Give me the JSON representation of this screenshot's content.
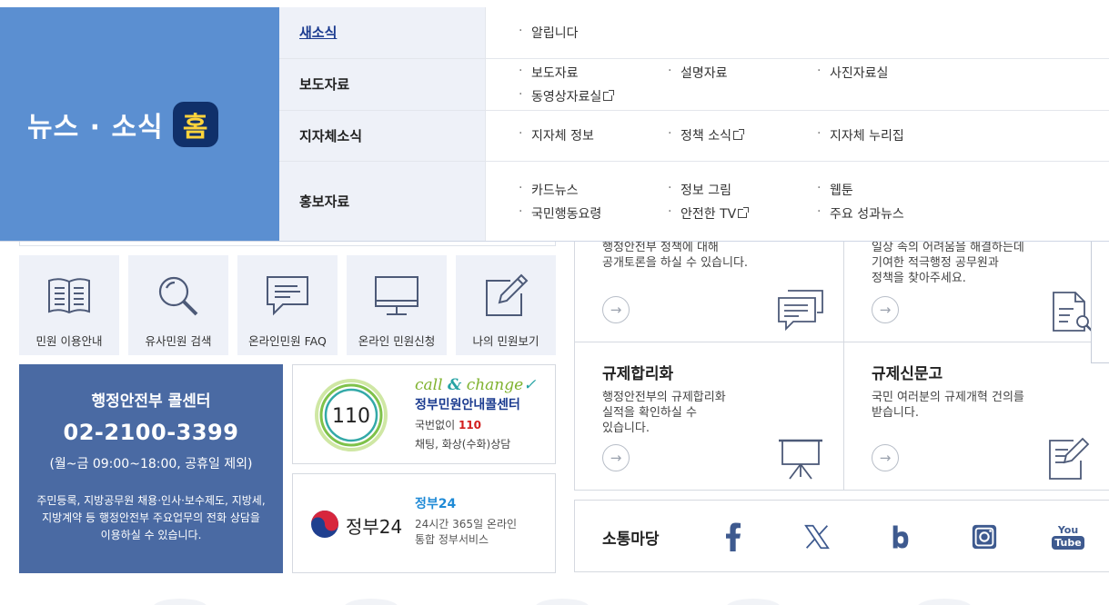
{
  "menu": {
    "hero_title": "뉴스 · 소식",
    "hero_badge": "홈",
    "rows": [
      {
        "category": "새소식",
        "items": [
          "알립니다"
        ]
      },
      {
        "category": "보도자료",
        "items": [
          "보도자료",
          "설명자료",
          "사진자료실",
          "동영상자료실"
        ]
      },
      {
        "category": "지자체소식",
        "items": [
          "지자체 정보",
          "정책 소식",
          "지자체 누리집"
        ]
      },
      {
        "category": "홍보자료",
        "items": [
          "카드뉴스",
          "정보 그림",
          "웹툰",
          "국민행동요령",
          "안전한 TV",
          "주요 성과뉴스"
        ]
      }
    ]
  },
  "quick_links": [
    {
      "label": "민원 이용안내",
      "icon": "book-icon"
    },
    {
      "label": "유사민원 검색",
      "icon": "magnifier-icon"
    },
    {
      "label": "온라인민원 FAQ",
      "icon": "chat-icon"
    },
    {
      "label": "온라인 민원신청",
      "icon": "monitor-icon"
    },
    {
      "label": "나의 민원보기",
      "icon": "edit-icon"
    }
  ],
  "call_center": {
    "title": "행정안전부 콜센터",
    "phone": "02-2100-3399",
    "hours": "(월~금 09:00~18:00, 공휴일 제외)",
    "desc": "주민등록, 지방공무원 채용·인사·보수제도, 지방세, 지방계약 등 행정안전부 주요업무의 전화 상담을 이용하실 수 있습니다."
  },
  "card110": {
    "logo_number": "110",
    "brand_call": "call ",
    "brand_amp": "&",
    "brand_change": " change",
    "name": "정부민원안내콜센터",
    "line1_prefix": "국번없이 ",
    "line1_number": "110",
    "line2": "채팅, 화상(수화)상담"
  },
  "card24": {
    "logo_text": "정부24",
    "name": "정부24",
    "line1": "24시간 365일 온라인",
    "line2": "통합 정부서비스"
  },
  "right_grid": {
    "top_left_desc": [
      "행정안전부 정책에 대해",
      "공개토론을 하실 수 있습니다."
    ],
    "top_right_desc": [
      "일상 속의 어려움을 해결하는데",
      "기여한 적극행정 공무원과",
      "정책을 찾아주세요."
    ],
    "bottom_left": {
      "title": "규제합리화",
      "desc": [
        "행정안전부의 규제합리화",
        "실적을 확인하실 수",
        "있습니다."
      ]
    },
    "bottom_right": {
      "title": "규제신문고",
      "desc": [
        "국민 여러분의 규제개혁 건의를",
        "받습니다."
      ]
    }
  },
  "social": {
    "title": "소통마당",
    "icons": [
      "facebook-icon",
      "x-icon",
      "blog-icon",
      "instagram-icon",
      "youtube-icon"
    ],
    "youtube_top": "You",
    "youtube_bottom": "Tube"
  },
  "colors": {
    "hero": "#5b8fd1",
    "callcenter": "#4a6aa3",
    "accent": "#1a3a8f",
    "icon": "#4d5a78"
  }
}
